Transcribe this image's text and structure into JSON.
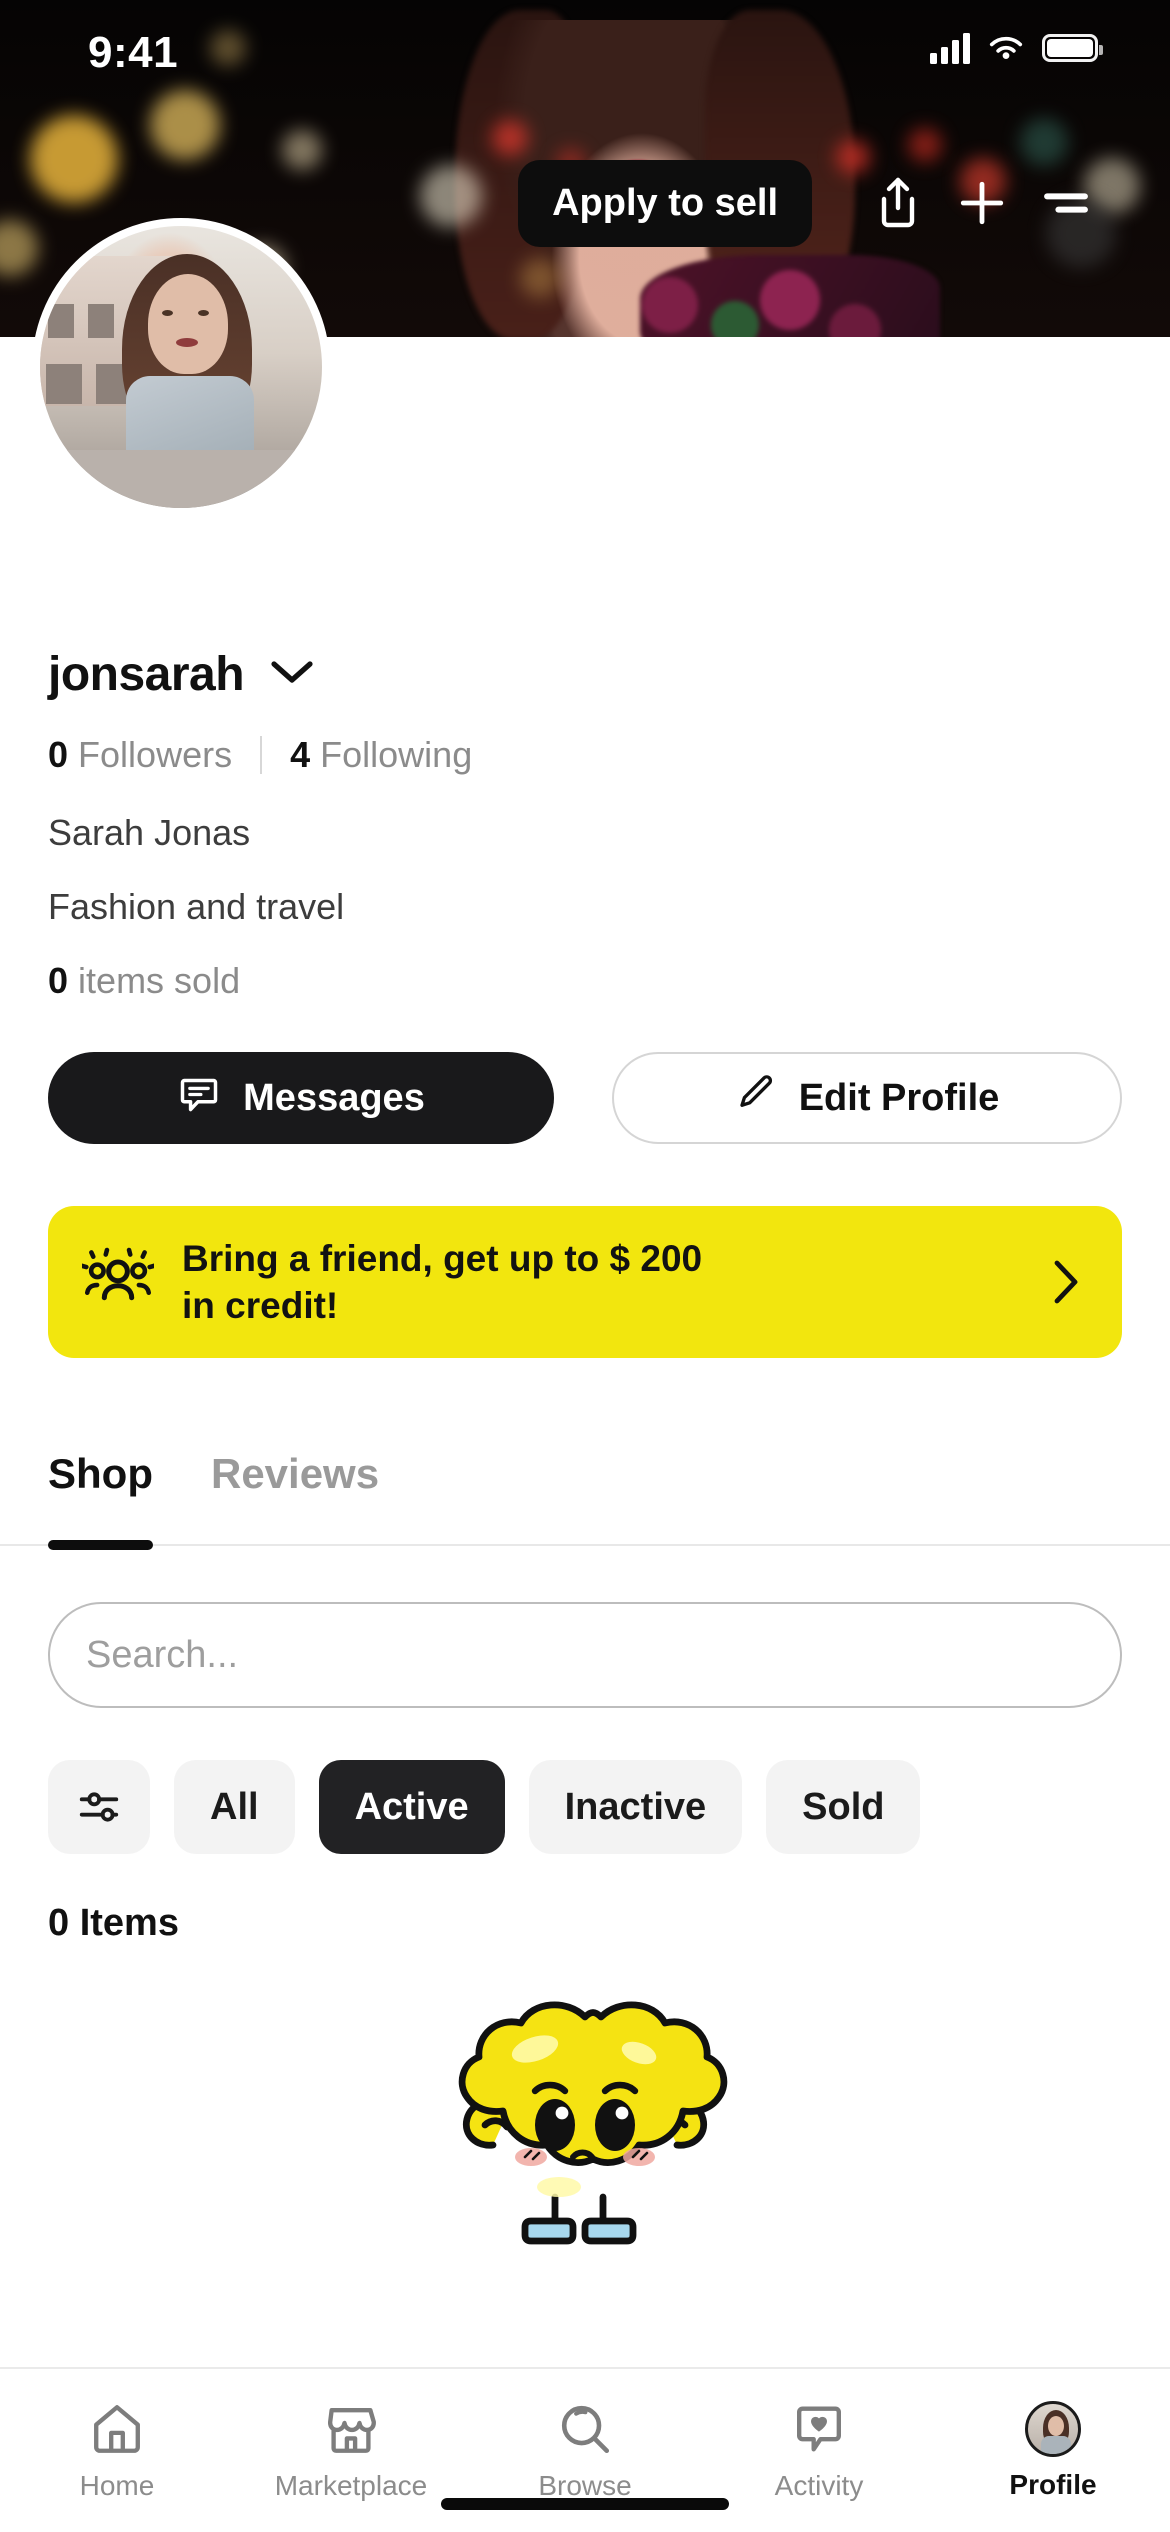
{
  "status_bar": {
    "time": "9:41",
    "signal_icon": "cellular-signal-icon",
    "wifi_icon": "wifi-icon",
    "battery_icon": "battery-icon"
  },
  "header": {
    "apply_label": "Apply to sell",
    "share_icon": "share-icon",
    "add_icon": "plus-icon",
    "menu_icon": "hamburger-menu-icon",
    "cover_photo_alt": "cover-photo",
    "avatar_alt": "profile-avatar"
  },
  "profile": {
    "username": "jonsarah",
    "chevron_icon": "chevron-down-icon",
    "followers_count": "0",
    "followers_label": "Followers",
    "following_count": "4",
    "following_label": "Following",
    "full_name": "Sarah Jonas",
    "bio": "Fashion and travel",
    "items_sold_count": "0",
    "items_sold_label": "items sold"
  },
  "actions": {
    "messages_label": "Messages",
    "messages_icon": "message-bubble-icon",
    "edit_profile_label": "Edit Profile",
    "edit_profile_icon": "pencil-icon"
  },
  "referral_banner": {
    "text": "Bring a friend, get up to $ 200 in credit!",
    "line1": "Bring a friend, get up to $ 200",
    "line2": "in credit!",
    "people_icon": "people-group-icon",
    "arrow_icon": "chevron-right-icon",
    "background_color": "#F2E60E"
  },
  "tabs": [
    {
      "label": "Shop",
      "active": true
    },
    {
      "label": "Reviews",
      "active": false
    }
  ],
  "search": {
    "placeholder": "Search...",
    "value": ""
  },
  "filters": {
    "filter_icon": "sliders-filter-icon",
    "chips": [
      {
        "label": "All",
        "selected": false
      },
      {
        "label": "Active",
        "selected": true
      },
      {
        "label": "Inactive",
        "selected": false
      },
      {
        "label": "Sold",
        "selected": false
      }
    ]
  },
  "listing": {
    "items_count_label": "0 Items",
    "empty_illustration": "yellow-flexing-cloud-mascot"
  },
  "bottom_nav": [
    {
      "label": "Home",
      "icon": "home-icon",
      "active": false
    },
    {
      "label": "Marketplace",
      "icon": "storefront-icon",
      "active": false
    },
    {
      "label": "Browse",
      "icon": "search-magnifier-icon",
      "active": false
    },
    {
      "label": "Activity",
      "icon": "heart-bubble-icon",
      "active": false
    },
    {
      "label": "Profile",
      "icon": "avatar-icon",
      "active": true
    }
  ],
  "colors": {
    "accent_yellow": "#F2E60E",
    "dark": "#19191b",
    "muted_text": "#8b8b8b"
  }
}
